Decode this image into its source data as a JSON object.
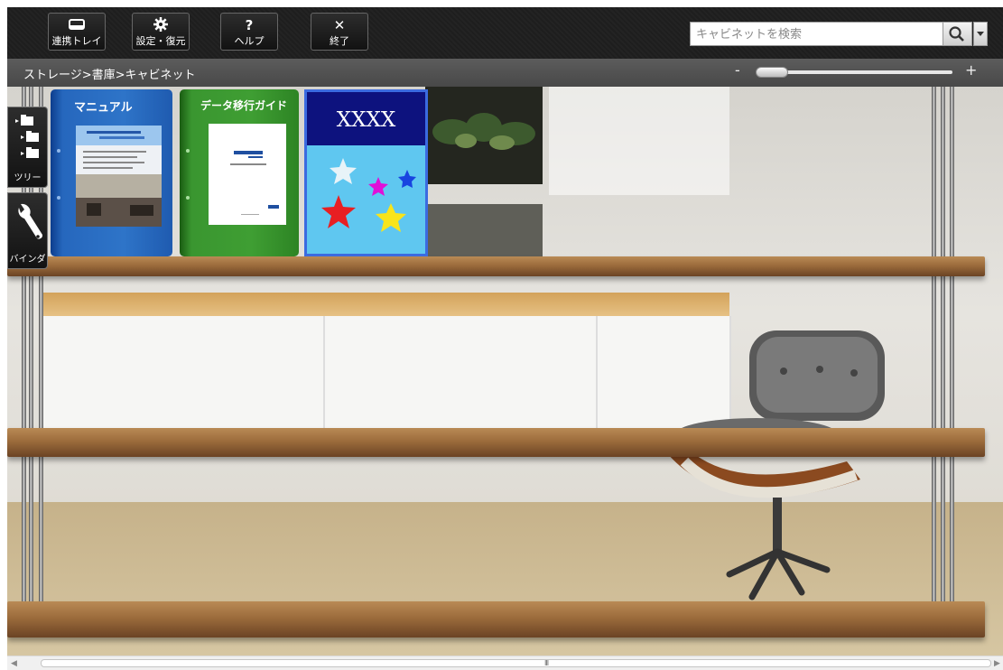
{
  "toolbar": {
    "buttons": [
      {
        "label": "連携トレイ",
        "icon": "tray-icon"
      },
      {
        "label": "設定・復元",
        "icon": "gear-icon"
      },
      {
        "label": "ヘルプ",
        "icon": "help-icon",
        "glyph": "?"
      },
      {
        "label": "終了",
        "icon": "close-icon",
        "glyph": "✕"
      }
    ],
    "search": {
      "placeholder": "キャビネットを検索",
      "value": ""
    }
  },
  "breadcrumb": "ストレージ>書庫>キャビネット",
  "zoom": {
    "minus": "-",
    "plus": "+"
  },
  "sidebar": {
    "tree_label": "ツリー",
    "binder_label": "バインダ"
  },
  "books": [
    {
      "title": "マニュアル",
      "color": "#2e74c8"
    },
    {
      "title": "データ移行ガイド",
      "color": "#3f9e33"
    },
    {
      "title": "XXXX",
      "color": "#5fc7f0"
    }
  ],
  "scrollbar": {
    "grip": "III"
  }
}
